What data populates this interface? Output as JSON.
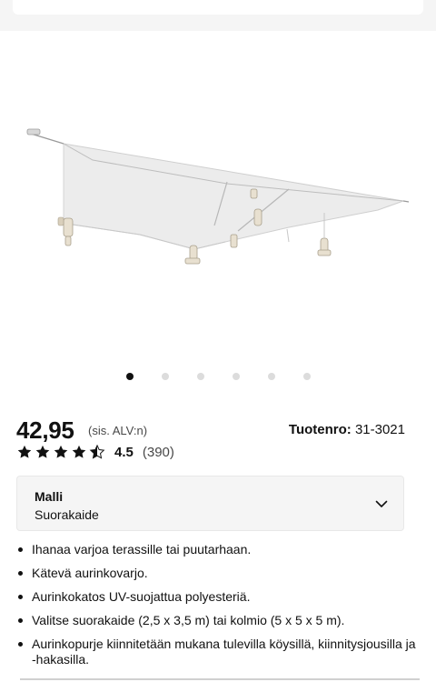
{
  "carousel": {
    "total": 6,
    "active_index": 0
  },
  "product": {
    "price": "42,95",
    "vat_note": "(sis. ALV:n)",
    "product_number_label": "Tuotenro:",
    "product_number": "31-3021",
    "rating_value": "4.5",
    "rating_stars": 4.5,
    "rating_count": "(390)"
  },
  "variant": {
    "label": "Malli",
    "value": "Suorakaide"
  },
  "features": [
    "Ihanaa varjoa terassille tai puutarhaan.",
    "Kätevä aurinkovarjo.",
    "Aurinkokatos UV-suojattua polyesteriä.",
    "Valitse suorakaide (2,5 x 3,5 m) tai kolmio (5 x 5 x 5 m).",
    "Aurinkopurje kiinnitetään mukana tulevilla köysillä, kiinnitysjousilla ja -hakasilla."
  ],
  "colors": {
    "accent": "#111111",
    "dot_inactive": "#dcdcdc",
    "panel_bg": "#f5f5f5",
    "canopy": "#ececec"
  },
  "icons": {
    "star": "star-icon",
    "chevron": "chevron-down-icon"
  }
}
